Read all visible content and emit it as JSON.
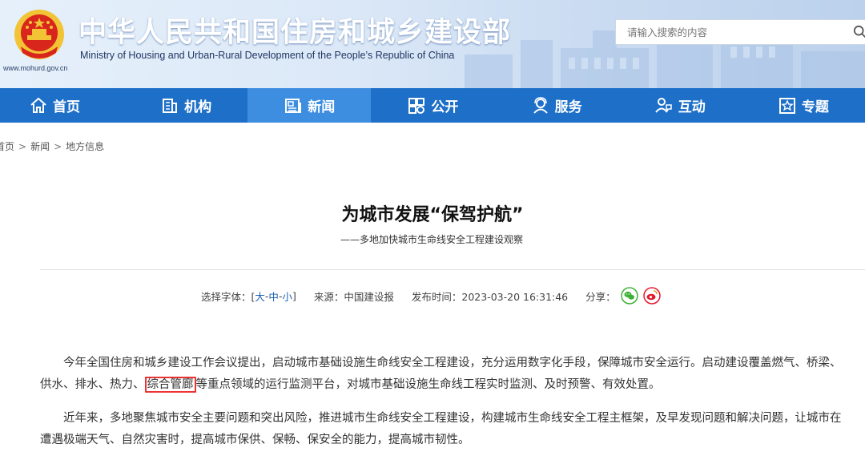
{
  "header": {
    "site_title": "中华人民共和国住房和城乡建设部",
    "site_subtitle": "Ministry of Housing and Urban-Rural Development of the People’s Republic of China",
    "site_url": "www.mohurd.gov.cn",
    "search_placeholder": "请输入搜索的内容"
  },
  "nav": {
    "items": [
      {
        "label": "首页",
        "icon": "home-icon"
      },
      {
        "label": "机构",
        "icon": "building-icon"
      },
      {
        "label": "新闻",
        "icon": "news-icon",
        "active": true
      },
      {
        "label": "公开",
        "icon": "open-icon"
      },
      {
        "label": "服务",
        "icon": "service-icon"
      },
      {
        "label": "互动",
        "icon": "interact-icon"
      },
      {
        "label": "专题",
        "icon": "topic-icon"
      }
    ]
  },
  "breadcrumb": {
    "items": [
      "首页",
      "新闻",
      "地方信息"
    ],
    "separator": ">"
  },
  "article": {
    "title": "为城市发展“保驾护航”",
    "subtitle": "——多地加快城市生命线安全工程建设观察",
    "meta": {
      "font_label": "选择字体：[",
      "font_large": "大",
      "font_medium": "中",
      "font_small": "小",
      "font_sep": " - ",
      "font_close": "]",
      "source_label": "来源：中国建设报",
      "time_label": "发布时间：2023-03-20 16:31:46",
      "share_label": "分享："
    },
    "paragraph1_before": "今年全国住房和城乡建设工作会议提出，启动城市基础设施生命线安全工程建设，充分运用数字化手段，保障城市安全运行。启动建设覆盖燃气、桥梁、供水、排水、热力、",
    "paragraph1_highlight": "综合管廊",
    "paragraph1_after": "等重点领域的运行监测平台，对城市基础设施生命线工程实时监测、及时预警、有效处置。",
    "paragraph2": "近年来，多地聚焦城市安全主要问题和突出风险，推进城市生命线安全工程建设，构建城市生命线安全工程主框架，及早发现问题和解决问题，让城市在遭遇极端天气、自然灾害时，提高城市保供、保畅、保安全的能力，提高城市韧性。"
  },
  "colors": {
    "nav_bg": "#1d6fc8",
    "nav_active": "#3d8ee0",
    "highlight_border": "#e33333",
    "wechat": "#3cb034",
    "weibo": "#e6162d"
  }
}
